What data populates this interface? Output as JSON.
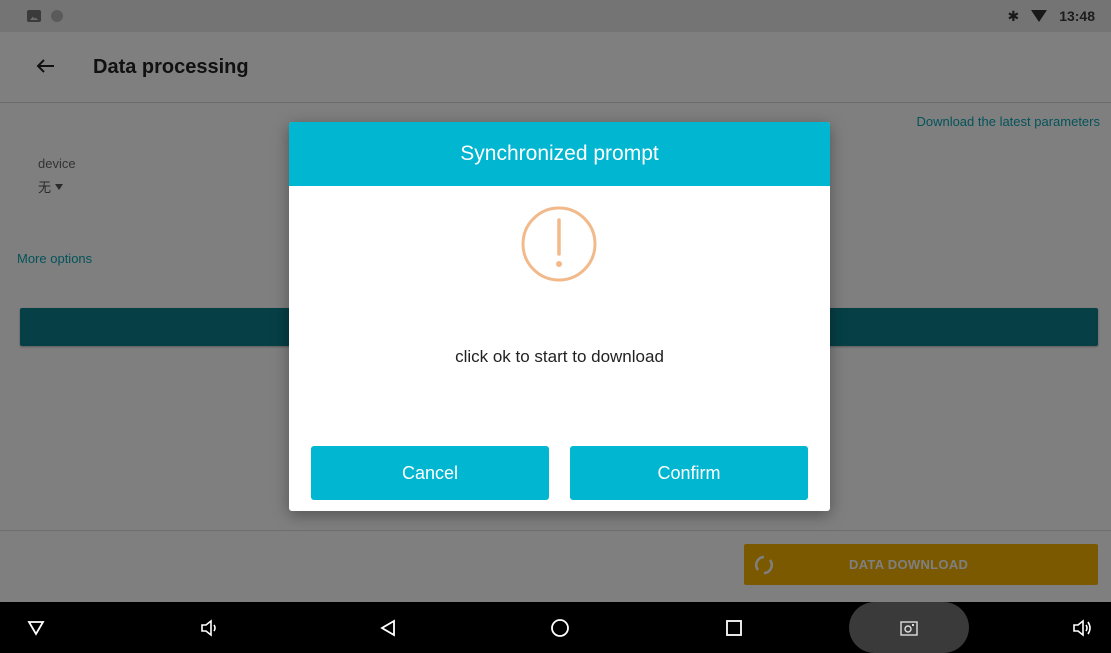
{
  "status_bar": {
    "time": "13:48"
  },
  "app_bar": {
    "title": "Data processing"
  },
  "main": {
    "download_latest_link": "Download the latest parameters",
    "device_label": "device",
    "device_value": "无",
    "more_options_link": "More options",
    "data_download_button": "DATA DOWNLOAD"
  },
  "dialog": {
    "title": "Synchronized prompt",
    "message": "click ok to start to download",
    "cancel_label": "Cancel",
    "confirm_label": "Confirm"
  },
  "colors": {
    "dialog_accent": "#00b6d1",
    "warning_icon": "#f2b98a",
    "link": "#0aa6b5",
    "action_button": "#f5b300"
  },
  "icons": {
    "nav": [
      "hide-nav-icon",
      "volume-down-icon",
      "back-icon",
      "home-icon",
      "recents-icon",
      "screenshot-icon",
      "volume-up-icon"
    ]
  }
}
